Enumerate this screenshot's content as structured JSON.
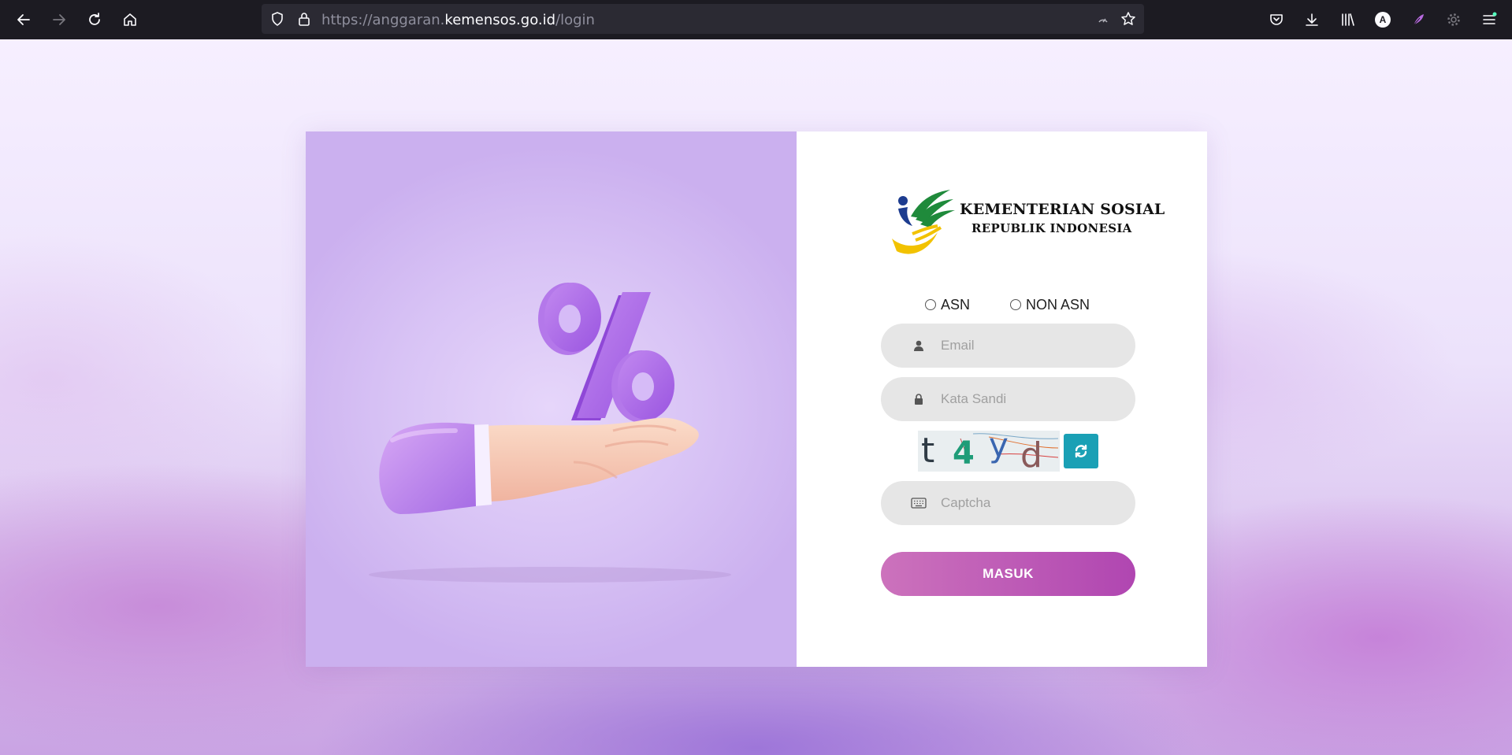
{
  "browser": {
    "url_prefix": "https://anggaran.",
    "url_host": "kemensos.go.id",
    "url_path": "/login",
    "profile_initial": "A"
  },
  "logo": {
    "line1": "KEMENTERIAN SOSIAL",
    "line2": "REPUBLIK INDONESIA"
  },
  "login": {
    "radio_asn": "ASN",
    "radio_non_asn": "NON ASN",
    "email_placeholder": "Email",
    "password_placeholder": "Kata Sandi",
    "captcha_placeholder": "Captcha",
    "captcha_text": [
      "t",
      "4",
      "y",
      "d"
    ],
    "submit_label": "MASUK"
  },
  "illustration": {
    "symbol": "%"
  },
  "colors": {
    "button_start": "#cc72bc",
    "button_end": "#b046b1",
    "refresh": "#1aa0b5"
  }
}
